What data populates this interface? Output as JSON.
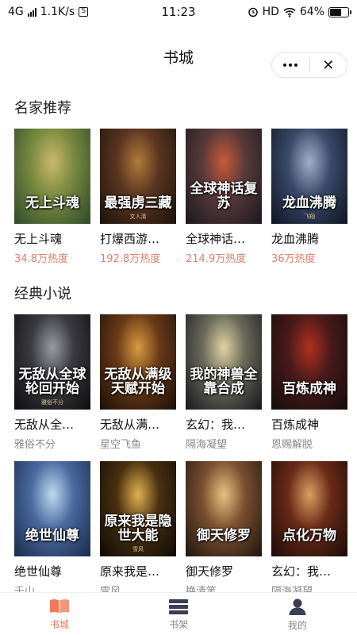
{
  "status": {
    "network": "4G",
    "speed": "1.1K/s",
    "time": "11:23",
    "hd": "HD",
    "battery": "64%",
    "battery_level": 0.64
  },
  "nav": {
    "title": "书城",
    "more_icon": "more-dots-icon",
    "close_label": "✕"
  },
  "sections": [
    {
      "title": "名家推荐",
      "books": [
        {
          "name": "无上斗魂",
          "meta": "34.8万热度",
          "cover_title": "无上斗魂",
          "cover_author": "",
          "colors": [
            "#2d4a2a",
            "#7a8a40",
            "#c9b96a"
          ]
        },
        {
          "name": "打爆西游…",
          "meta": "192.8万热度",
          "cover_title": "最强虏三藏",
          "cover_author": "文人清",
          "colors": [
            "#1b120c",
            "#5a3520",
            "#b07a3a"
          ]
        },
        {
          "name": "全球神话…",
          "meta": "214.9万热度",
          "cover_title": "全球神话复苏",
          "cover_author": "",
          "colors": [
            "#1a1820",
            "#5a3a3a",
            "#c85a3a"
          ]
        },
        {
          "name": "龙血沸腾",
          "meta": "36万热度",
          "cover_title": "龙血沸腾",
          "cover_author": "飞翔",
          "colors": [
            "#0e1420",
            "#3a4a6a",
            "#a0b0c8"
          ]
        }
      ]
    },
    {
      "title": "经典小说",
      "books": [
        {
          "name": "无敌从全…",
          "meta": "雅俗不分",
          "cover_title": "无敌从全球轮回开始",
          "cover_author": "雅俗不分",
          "colors": [
            "#0d0d10",
            "#3a3a40",
            "#9a9aa4"
          ]
        },
        {
          "name": "无敌从满…",
          "meta": "星空飞鱼",
          "cover_title": "无敌从满级天赋开始",
          "cover_author": "",
          "colors": [
            "#1a0f08",
            "#6a3a18",
            "#d89a40"
          ]
        },
        {
          "name": "玄幻：我…",
          "meta": "隔海凝望",
          "cover_title": "我的神兽全靠合成",
          "cover_author": "",
          "colors": [
            "#16181c",
            "#6a6a5a",
            "#e0d2a0"
          ]
        },
        {
          "name": "百炼成神",
          "meta": "恩赐解脱",
          "cover_title": "百炼成神",
          "cover_author": "",
          "colors": [
            "#120c0c",
            "#4a1a1a",
            "#b03020"
          ]
        }
      ]
    },
    {
      "title": "",
      "books": [
        {
          "name": "绝世仙尊",
          "meta": "千山",
          "cover_title": "绝世仙尊",
          "cover_author": "",
          "colors": [
            "#1a2a4a",
            "#4a6aa0",
            "#c0d8f0"
          ]
        },
        {
          "name": "原来我是…",
          "meta": "雪风",
          "cover_title": "原来我是隐世大能",
          "cover_author": "雪风",
          "colors": [
            "#0e0a06",
            "#4a3010",
            "#e0b050"
          ]
        },
        {
          "name": "御天修罗",
          "meta": "换清笔",
          "cover_title": "御天修罗",
          "cover_author": "",
          "colors": [
            "#201410",
            "#7a5030",
            "#e8c080"
          ]
        },
        {
          "name": "玄幻：我…",
          "meta": "隔海凝望",
          "cover_title": "点化万物",
          "cover_author": "",
          "colors": [
            "#1a0c08",
            "#6a2a18",
            "#d8a060"
          ]
        }
      ]
    }
  ],
  "tabs": [
    {
      "label": "书城",
      "icon": "open-book-icon",
      "active": true
    },
    {
      "label": "书架",
      "icon": "bookshelf-icon",
      "active": false
    },
    {
      "label": "我的",
      "icon": "user-icon",
      "active": false
    }
  ],
  "colors": {
    "accent": "#f07a59",
    "heat": "#e07f6a",
    "muted": "#888888"
  }
}
